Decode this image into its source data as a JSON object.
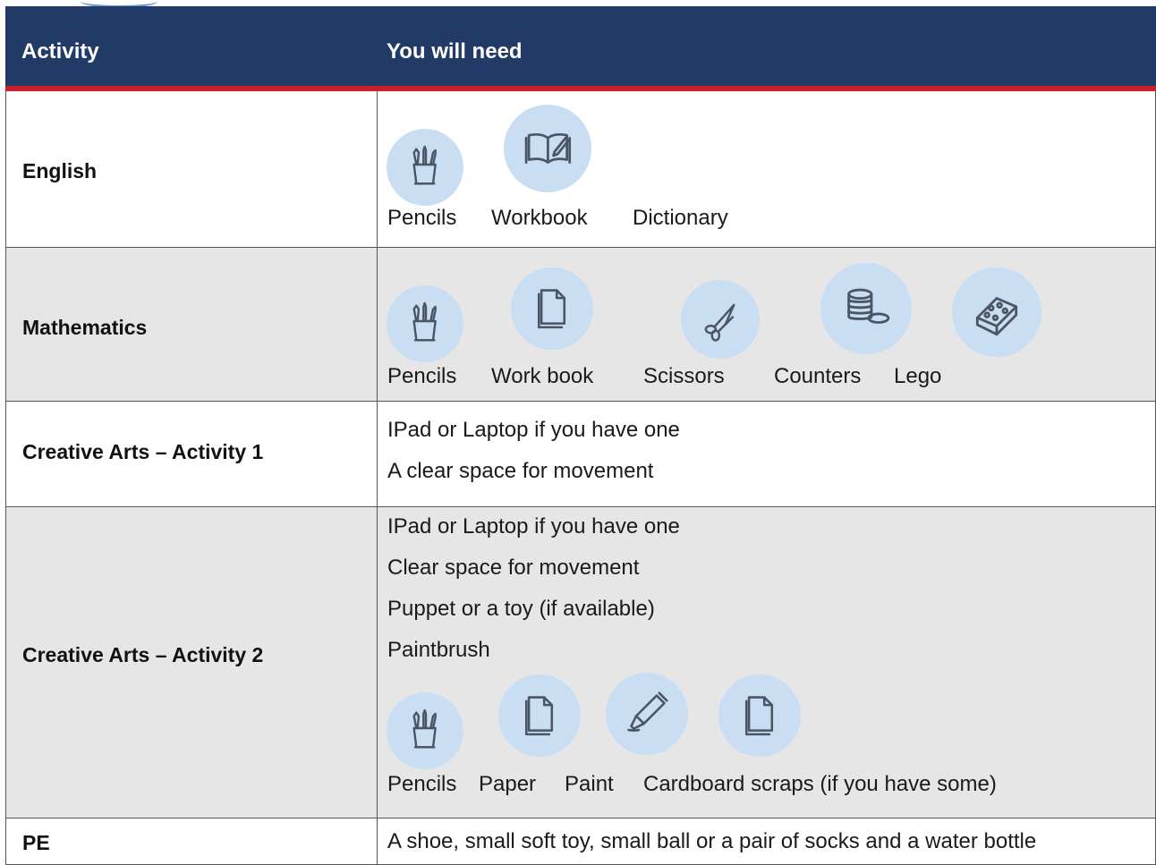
{
  "header": {
    "col1": "Activity",
    "col2": "You will need"
  },
  "rows": [
    {
      "subject": "English",
      "items": [
        {
          "icon": "pencils-icon",
          "label": "Pencils"
        },
        {
          "icon": "workbook-icon",
          "label": "Workbook"
        },
        {
          "icon": "",
          "label": "Dictionary"
        }
      ]
    },
    {
      "subject": "Mathematics",
      "items": [
        {
          "icon": "pencils-icon",
          "label": "Pencils"
        },
        {
          "icon": "paper-icon",
          "label": "Work book"
        },
        {
          "icon": "scissors-icon",
          "label": "Scissors"
        },
        {
          "icon": "coins-icon",
          "label": "Counters"
        },
        {
          "icon": "lego-icon",
          "label": "Lego"
        }
      ]
    },
    {
      "subject": "Creative Arts – Activity 1",
      "lines": [
        "IPad or Laptop if you have one",
        "A clear space for movement"
      ]
    },
    {
      "subject": "Creative Arts – Activity 2",
      "lines": [
        "IPad or Laptop if you have one",
        "Clear space for movement",
        "Puppet or a toy (if available)",
        "Paintbrush"
      ],
      "items": [
        {
          "icon": "pencils-icon",
          "label": "Pencils"
        },
        {
          "icon": "paper-icon",
          "label": "Paper"
        },
        {
          "icon": "paint-tube-icon",
          "label": "Paint"
        },
        {
          "icon": "paper-icon",
          "label": "Cardboard scraps (if you have some)"
        }
      ]
    },
    {
      "subject": "PE",
      "lines": [
        "A shoe, small soft toy, small ball or a pair of socks and a water bottle"
      ]
    }
  ],
  "colors": {
    "header_bg": "#223a66",
    "header_rule": "#c8202b",
    "icon_bg": "#c9ddf3",
    "shaded_row": "#e6e6e6"
  }
}
